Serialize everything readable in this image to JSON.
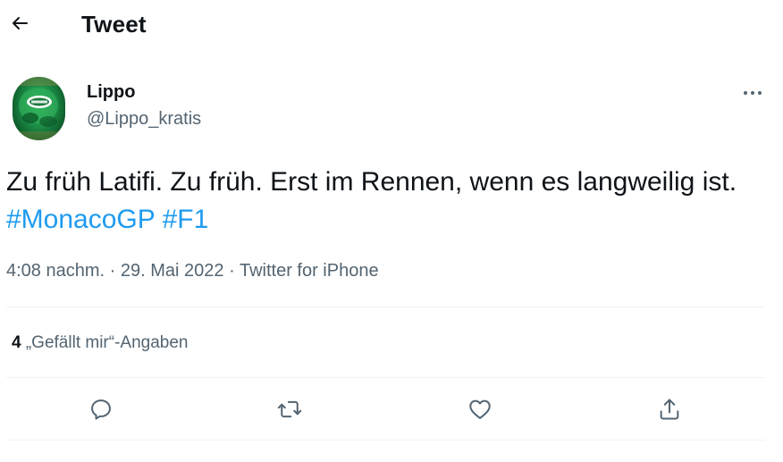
{
  "header": {
    "back_icon": "arrow-left-icon",
    "title": "Tweet"
  },
  "author": {
    "display_name": "Lippo",
    "handle": "@Lippo_kratis",
    "avatar_description_icon": "jets-helmet-avatar",
    "more_icon": "more-horizontal-icon"
  },
  "tweet": {
    "text_plain": "Zu früh Latifi. Zu früh. Erst im Rennen, wenn es langweilig ist.",
    "hashtag_1": "#MonacoGP",
    "hashtag_2": "#F1"
  },
  "meta": {
    "time": "4:08 nachm.",
    "separator_1": "·",
    "date": "29. Mai 2022",
    "separator_2": "·",
    "source": "Twitter for iPhone"
  },
  "stats": {
    "likes_count": "4",
    "likes_label": "„Gefällt mir“-Angaben"
  },
  "actions": {
    "reply_icon": "reply-icon",
    "retweet_icon": "retweet-icon",
    "like_icon": "heart-icon",
    "share_icon": "share-icon"
  },
  "colors": {
    "text_primary": "#0f1419",
    "text_secondary": "#536471",
    "hashtag": "#1d9bf0",
    "divider": "#eff3f4"
  }
}
